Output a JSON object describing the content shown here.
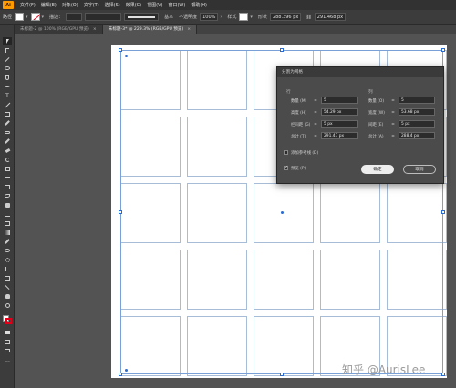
{
  "app": {
    "logo": "Ai"
  },
  "menubar": {
    "items": [
      "文件(F)",
      "编辑(E)",
      "对象(O)",
      "文字(T)",
      "选择(S)",
      "效果(C)",
      "视图(V)",
      "窗口(W)",
      "帮助(H)"
    ]
  },
  "controlbar": {
    "path_label": "路径",
    "stroke_label": "描边：",
    "stroke_style": "基本",
    "opacity_label": "不透明度",
    "opacity_value": "100%",
    "style_label": "样式",
    "shape_label": "形状",
    "width_value": "288.396 px",
    "height_value": "291.468 px"
  },
  "tabs": [
    {
      "label": "未标题-2 @ 100% (RGB/GPU 预览)",
      "close": "×"
    },
    {
      "label": "未标题-3* @ 229.3% (RGB/GPU 预览)",
      "close": "×"
    }
  ],
  "dialog": {
    "title": "分割为网格",
    "rows": {
      "heading": "行",
      "count_label": "数量 (M)",
      "count_value": "5",
      "height_label": "高度 (H)",
      "height_value": "54.29 px",
      "gutter_label": "栏间距 (G)",
      "gutter_value": "5 px",
      "total_label": "总计 (T)",
      "total_value": "291.47 px"
    },
    "columns": {
      "heading": "列",
      "count_label": "数量 (O)",
      "count_value": "5",
      "width_label": "宽度 (W)",
      "width_value": "53.68 px",
      "gutter_label": "间距 (E)",
      "gutter_value": "5 px",
      "total_label": "总计 (A)",
      "total_value": "288.4 px"
    },
    "add_guides_label": "添加参考线 (D)",
    "add_guides_checked": false,
    "preview_label": "预览 (P)",
    "preview_checked": true,
    "ok_label": "确定",
    "cancel_label": "取消"
  },
  "watermark": "知乎 @AurisLee",
  "colors": {
    "accent": "#2a6bd1",
    "grid_stroke": "#a7bcd6",
    "canvas": "#535353"
  }
}
